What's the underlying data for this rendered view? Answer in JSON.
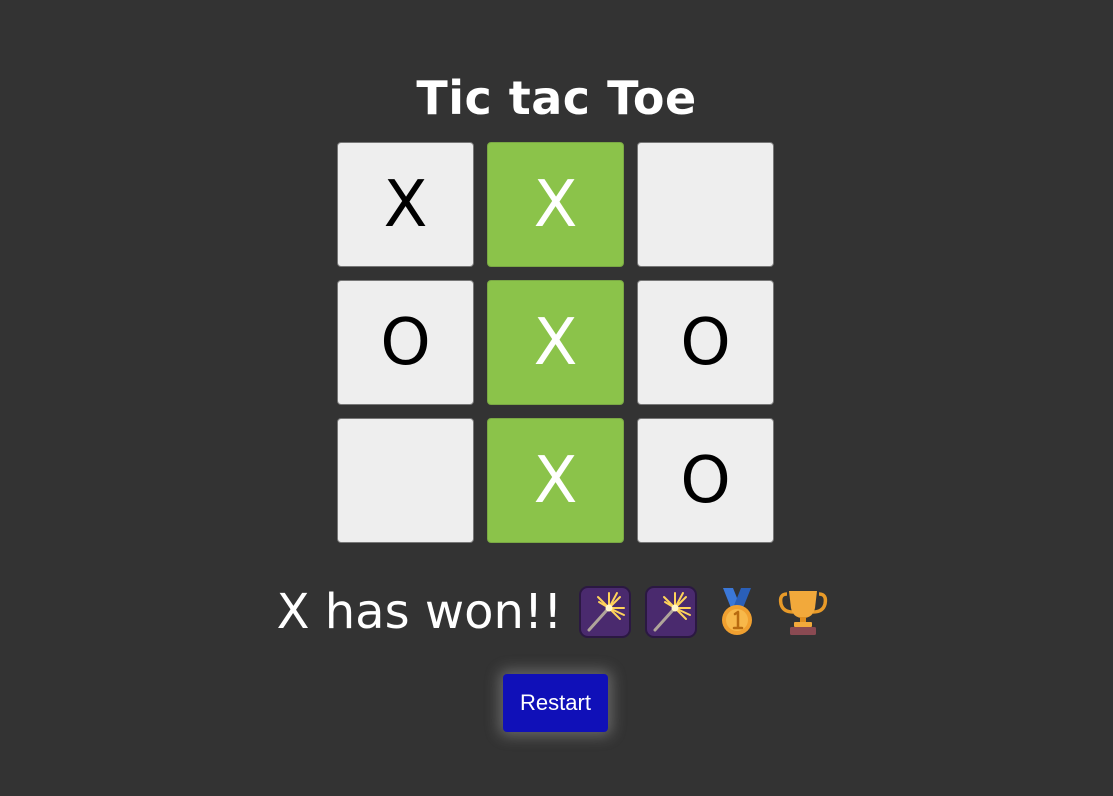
{
  "title": "Tic tac Toe",
  "board": {
    "cells": [
      "X",
      "X",
      "",
      "O",
      "X",
      "O",
      "",
      "X",
      "O"
    ],
    "winning_cells": [
      1,
      4,
      7
    ]
  },
  "status": {
    "text": "X has won!!",
    "icons": [
      "sparkler-icon",
      "sparkler-icon",
      "first-place-medal-icon",
      "trophy-icon"
    ]
  },
  "restart_label": "Restart",
  "colors": {
    "background": "#333333",
    "cell": "#eeeeee",
    "win_cell": "#8bc34a",
    "button": "#1010b8"
  }
}
